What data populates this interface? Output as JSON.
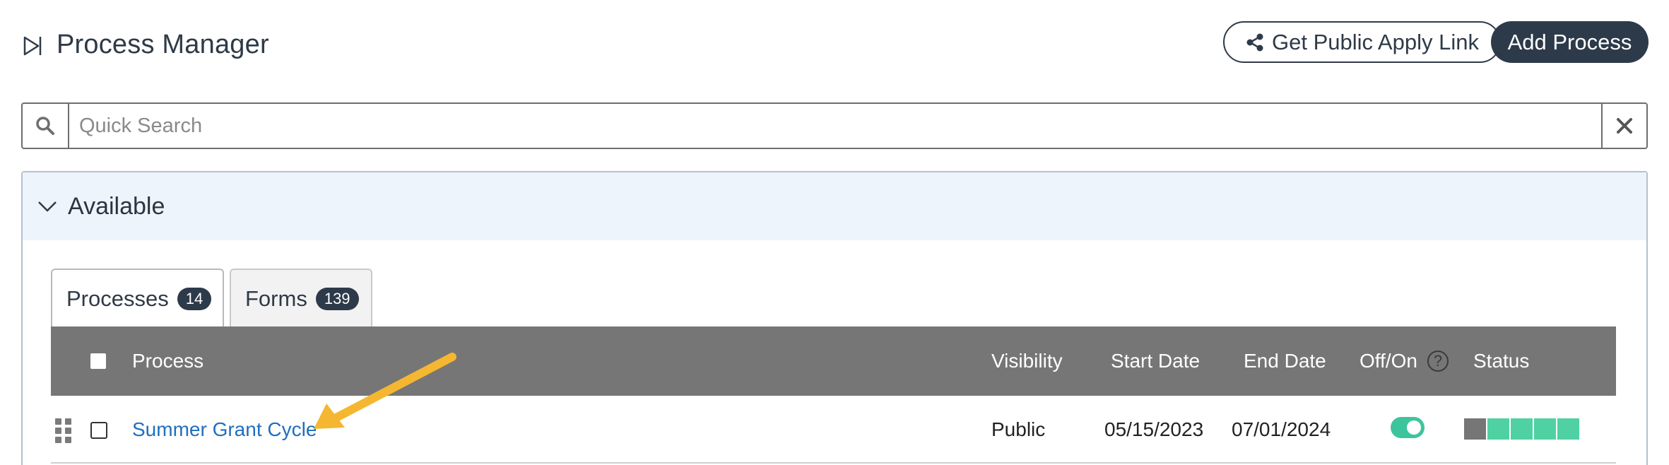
{
  "header": {
    "title": "Process Manager",
    "public_link_label": "Get Public Apply Link",
    "add_process_label": "Add Process"
  },
  "search": {
    "placeholder": "Quick Search",
    "value": ""
  },
  "panel": {
    "title": "Available",
    "tabs": [
      {
        "label": "Processes",
        "count": "14",
        "active": true
      },
      {
        "label": "Forms",
        "count": "139",
        "active": false
      }
    ]
  },
  "table": {
    "columns": {
      "process": "Process",
      "visibility": "Visibility",
      "start_date": "Start Date",
      "end_date": "End Date",
      "off_on": "Off/On",
      "status": "Status"
    },
    "rows": [
      {
        "process": "Summer Grant Cycle",
        "visibility": "Public",
        "start_date": "05/15/2023",
        "end_date": "07/01/2024",
        "enabled": true,
        "status_segments": [
          "grey",
          "green",
          "green",
          "green",
          "green"
        ]
      }
    ]
  },
  "colors": {
    "dark": "#2d3a4a",
    "link": "#1f6fbf",
    "toggle_on": "#3ec49c",
    "status_green": "#4fd1a3",
    "header_grey": "#767676",
    "panel_bg": "#eef4fb",
    "annotation_arrow": "#f5b731"
  },
  "icons": {
    "page": "play-panel-icon",
    "share": "share-icon",
    "search": "search-icon",
    "clear": "close-icon",
    "collapse": "chevron-down-icon",
    "drag": "drag-handle-icon",
    "help": "help-circle-icon"
  }
}
